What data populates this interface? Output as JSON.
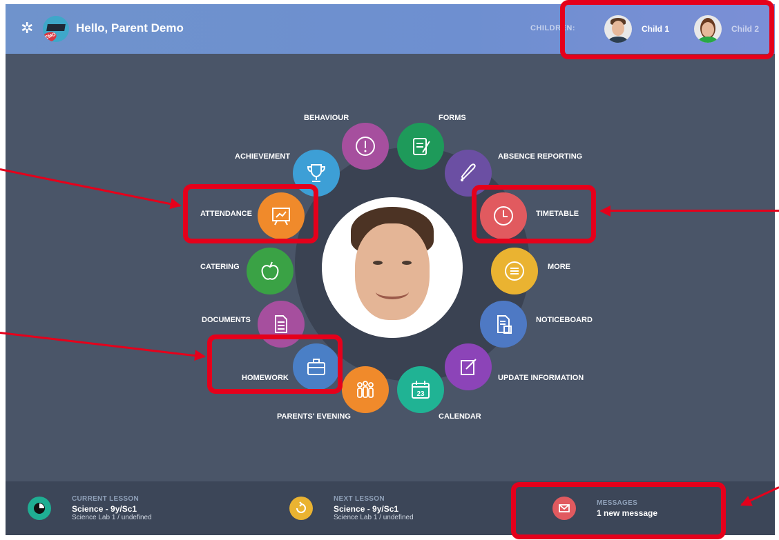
{
  "header": {
    "greeting": "Hello, Parent Demo",
    "demo_badge": "DEMO",
    "children_label": "CHILDREN:",
    "children": [
      {
        "name": "Child 1",
        "selected": true
      },
      {
        "name": "Child 2",
        "selected": false
      }
    ]
  },
  "menu": [
    {
      "key": "behaviour",
      "label": "BEHAVIOUR",
      "color": "#a64f9e",
      "icon": "alert-circle-icon"
    },
    {
      "key": "forms",
      "label": "FORMS",
      "color": "#1e9a5a",
      "icon": "form-edit-icon"
    },
    {
      "key": "absence",
      "label": "ABSENCE REPORTING",
      "color": "#6b4fa3",
      "icon": "bell-icon"
    },
    {
      "key": "timetable",
      "label": "TIMETABLE",
      "color": "#e15a5f",
      "icon": "clock-icon"
    },
    {
      "key": "more",
      "label": "MORE",
      "color": "#eab331",
      "icon": "menu-icon"
    },
    {
      "key": "noticeboard",
      "label": "NOTICEBOARD",
      "color": "#4e79c4",
      "icon": "document-download-icon"
    },
    {
      "key": "update",
      "label": "UPDATE INFORMATION",
      "color": "#8c44b8",
      "icon": "pencil-icon"
    },
    {
      "key": "calendar",
      "label": "CALENDAR",
      "color": "#20b394",
      "icon": "calendar-icon",
      "day": "23"
    },
    {
      "key": "parents_evening",
      "label": "PARENTS' EVENING",
      "color": "#f08a2b",
      "icon": "people-icon"
    },
    {
      "key": "homework",
      "label": "HOMEWORK",
      "color": "#4a7fc6",
      "icon": "briefcase-icon"
    },
    {
      "key": "documents",
      "label": "DOCUMENTS",
      "color": "#a64f9e",
      "icon": "document-icon"
    },
    {
      "key": "catering",
      "label": "CATERING",
      "color": "#3aa245",
      "icon": "apple-icon"
    },
    {
      "key": "attendance",
      "label": "ATTENDANCE",
      "color": "#f08a2b",
      "icon": "presentation-chart-icon"
    },
    {
      "key": "achievement",
      "label": "ACHIEVEMENT",
      "color": "#3d9fd6",
      "icon": "trophy-icon"
    }
  ],
  "footer": {
    "current": {
      "title": "CURRENT LESSON",
      "lesson": "Science - 9y/Sc1",
      "room": "Science Lab 1 / undefined",
      "color": "#1fae93"
    },
    "next": {
      "title": "NEXT LESSON",
      "lesson": "Science - 9y/Sc1",
      "room": "Science Lab 1 / undefined",
      "color": "#eab331"
    },
    "messages": {
      "title": "MESSAGES",
      "text": "1 new message",
      "color": "#e15a5f"
    }
  },
  "colors": {
    "annotation": "#e5001b",
    "background": "#4a5568",
    "header": "#6f93cc"
  }
}
